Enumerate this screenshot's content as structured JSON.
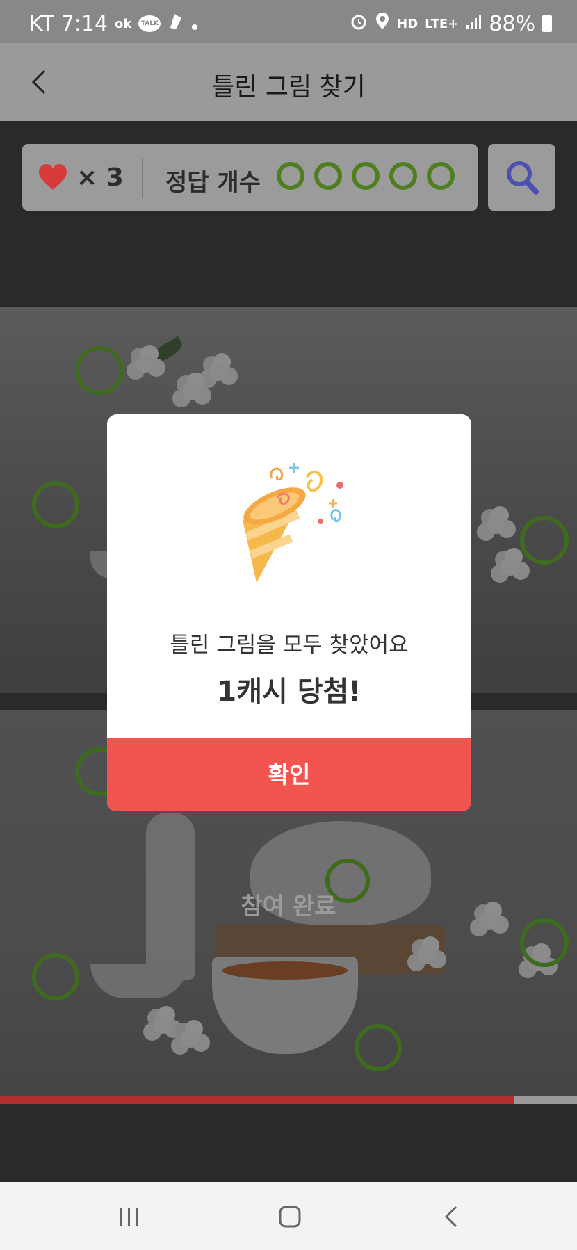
{
  "status_bar": {
    "carrier": "KT",
    "time": "7:14",
    "ok_label": "ok",
    "talk_label": "TALK",
    "hd_label": "HD",
    "network": "LTE+",
    "battery": "88%"
  },
  "header": {
    "title": "틀린 그림 찾기",
    "back_icon": "chevron-left-icon"
  },
  "game_bar": {
    "lives_text": "× 3",
    "lives": 3,
    "answer_label": "정답 개수",
    "answers_found": 5,
    "answers_total": 5,
    "search_icon": "magnifier-icon",
    "colors": {
      "heart": "#d63a3a",
      "answer_ring": "#4d7e1f",
      "search": "#4f4fb0"
    }
  },
  "image_area": {
    "done_label": "참여 완료",
    "progress": 0.89,
    "progress_color": "#b32f2f"
  },
  "modal": {
    "illustration": "party-popper-icon",
    "message": "틀린 그림을 모두 찾았어요",
    "prize": "1캐시 당첨!",
    "confirm_label": "확인",
    "confirm_color": "#f25450"
  },
  "bottom_nav": {
    "recent_icon": "recent-apps-icon",
    "home_icon": "home-icon",
    "back_icon": "back-icon"
  }
}
